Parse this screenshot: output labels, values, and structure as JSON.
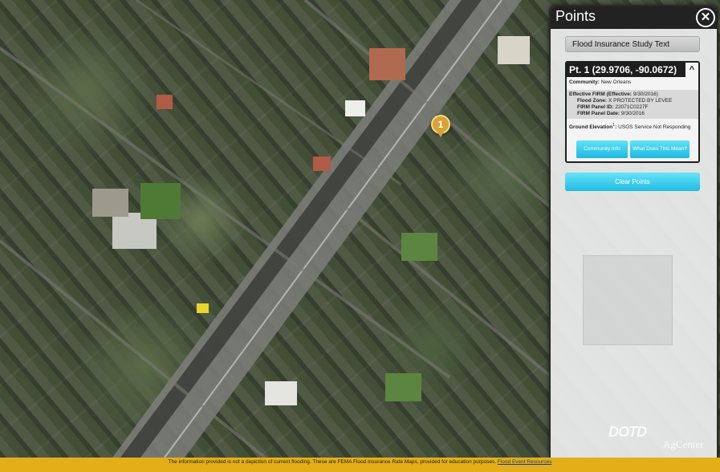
{
  "panel": {
    "title": "Points",
    "study_button": "Flood Insurance Study Text",
    "point_card": {
      "header": "Pt. 1 (29.9706, -90.0672)",
      "community_label": "Community:",
      "community_value": "New Orleans",
      "effective_firm_label": "Effective FIRM (Effective:",
      "effective_firm_date": "9/30/2016)",
      "flood_zone_label": "Flood Zone:",
      "flood_zone_value": "X PROTECTED BY LEVEE",
      "panel_id_label": "FIRM Panel ID:",
      "panel_id_value": "22071C0227F",
      "panel_date_label": "FIRM Panel Date:",
      "panel_date_value": "9/30/2016",
      "ground_elevation_label": "Ground Elevation",
      "ground_elevation_sup": "1",
      "ground_elevation_value": "USGS Service Not Responding",
      "community_info_button": "Community Info",
      "what_mean_button": "What Does This Mean?"
    },
    "clear_button": "Clear Points",
    "logo_text": "DOTD",
    "logo_text2": "AgCenter"
  },
  "map": {
    "marker_label": "1"
  },
  "footer": {
    "text": "The information provided is not a depiction of current flooding. These are FEMA Flood Insurance Rate Maps, provided for education purposes.",
    "link": "Flood Event Resources"
  },
  "colors": {
    "accent": "#22bce3",
    "footer_bg": "#e3ae17",
    "marker": "#d7a332"
  }
}
